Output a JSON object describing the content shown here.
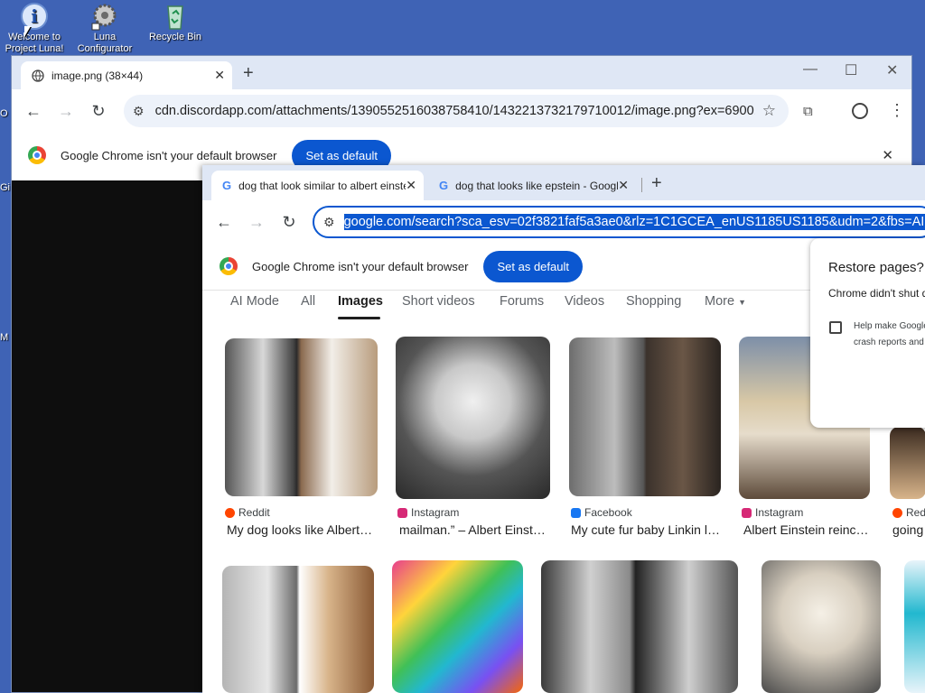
{
  "desktop": {
    "icons": [
      {
        "label": "Welcome to Project Luna!",
        "icon": "info-icon"
      },
      {
        "label": "Luna Configurator",
        "icon": "gear-icon"
      },
      {
        "label": "Recycle Bin",
        "icon": "recycle-bin-icon"
      }
    ],
    "edge_chars": [
      "O",
      "Gi",
      "M"
    ]
  },
  "back_window": {
    "tab_title": "image.png (38×44)",
    "url": "cdn.discordapp.com/attachments/1390552516038758410/1432213732179710012/image.png?ex=6900...",
    "default_browser_msg": "Google Chrome isn't your default browser",
    "set_default_label": "Set as default"
  },
  "front_window": {
    "tabs": [
      {
        "title": "dog that look similar to albert einstein - Google Search",
        "active": true
      },
      {
        "title": "dog that looks like epstein - Google Search",
        "active": false
      }
    ],
    "url": "google.com/search?sca_esv=02f3821faf5a3ae0&rlz=1C1GCEA_enUS1185US1185&udm=2&fbs=AIIjpHx",
    "default_browser_msg": "Google Chrome isn't your default browser",
    "set_default_label": "Set as default",
    "search_tabs": [
      "AI Mode",
      "All",
      "Images",
      "Short videos",
      "Forums",
      "Videos",
      "Shopping",
      "More"
    ],
    "active_search_tab": "Images",
    "results_row1": [
      {
        "source": "Reddit",
        "caption": "My dog looks like Albert Einstein",
        "source_color": "#ff4500"
      },
      {
        "source": "Instagram",
        "caption": "mailman.” – Albert Einstein",
        "source_color": "#d62976"
      },
      {
        "source": "Facebook",
        "caption": "My cute fur baby Linkin looks",
        "source_color": "#1877f2"
      },
      {
        "source": "Instagram",
        "caption": "Albert Einstein reincarnated",
        "source_color": "#d62976"
      },
      {
        "source": "Reddit",
        "caption": "going",
        "source_color": "#ff4500"
      }
    ],
    "restore_popup": {
      "title": "Restore pages?",
      "body": "Chrome didn't shut down correctly.",
      "checkbox_label_1": "Help make Google Chrome better by sending",
      "checkbox_label_2": "crash reports and"
    }
  }
}
